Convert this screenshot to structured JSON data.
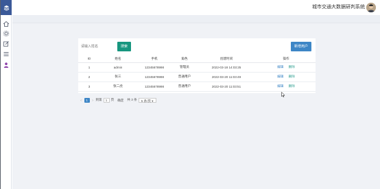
{
  "app": {
    "title": "城市交通大数据研判系统"
  },
  "sidebar": {
    "items": [
      {
        "icon": "home-icon"
      },
      {
        "icon": "settings-icon"
      },
      {
        "icon": "edit-icon"
      },
      {
        "icon": "list-icon"
      },
      {
        "icon": "user-icon"
      }
    ]
  },
  "toolbar": {
    "search_placeholder": "请输入姓名",
    "search_label": "搜索",
    "add_label": "新增用户"
  },
  "table": {
    "headers": [
      "ID",
      "姓名",
      "手机",
      "角色",
      "创建时间",
      "操作"
    ],
    "rows": [
      {
        "id": "1",
        "name": "admin",
        "phone": "12345678998",
        "role": "管理员",
        "created": "2022-03-18 14:03:25",
        "edit": "编辑",
        "del": "删除"
      },
      {
        "id": "2",
        "name": "张三",
        "phone": "12345678998",
        "role": "普通用户",
        "created": "2022-03-20 11:03:49",
        "edit": "编辑",
        "del": "删除"
      },
      {
        "id": "3",
        "name": "张二虎",
        "phone": "12345678998",
        "role": "普通用户",
        "created": "2022-03-20 11:03:51",
        "edit": "编辑",
        "del": "删除"
      }
    ]
  },
  "pagination": {
    "prev": "<",
    "current_page": "1",
    "next": ">",
    "goto_label": "到第",
    "goto_value": "1",
    "page_unit": "页",
    "confirm_label": "确定",
    "total_label": "共 3 条",
    "page_size": "5 条/页"
  }
}
